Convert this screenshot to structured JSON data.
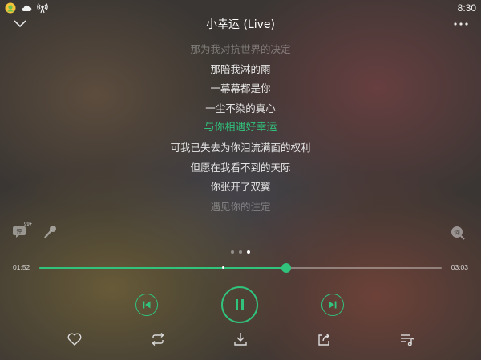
{
  "status_bar": {
    "icons": [
      "avatar-icon",
      "cloud-icon",
      "signal-tower-icon"
    ],
    "time": "8:30"
  },
  "header": {
    "title": "小幸运 (Live)",
    "collapse_icon": "chevron-down-icon",
    "more_icon": "more-dots-icon"
  },
  "lyrics": {
    "lines": [
      "那为我对抗世界的决定",
      "那陪我淋的雨",
      "一幕幕都是你",
      "一尘不染的真心",
      "与你相遇好幸运",
      "可我已失去为你泪流满面的权利",
      "但愿在我看不到的天际",
      "你张开了双翼",
      "遇见你的注定"
    ],
    "active_index": 4
  },
  "side_tools": {
    "comment_badge": "99+"
  },
  "pager": {
    "count": 3,
    "active": 2
  },
  "progress": {
    "elapsed": "01:52",
    "total": "03:03",
    "played_fraction": 0.6135,
    "buffer_mark_fraction": 0.458
  },
  "controls": {
    "state": "playing"
  },
  "colors": {
    "accent": "#31c27c",
    "text": "#e6e6e6"
  }
}
